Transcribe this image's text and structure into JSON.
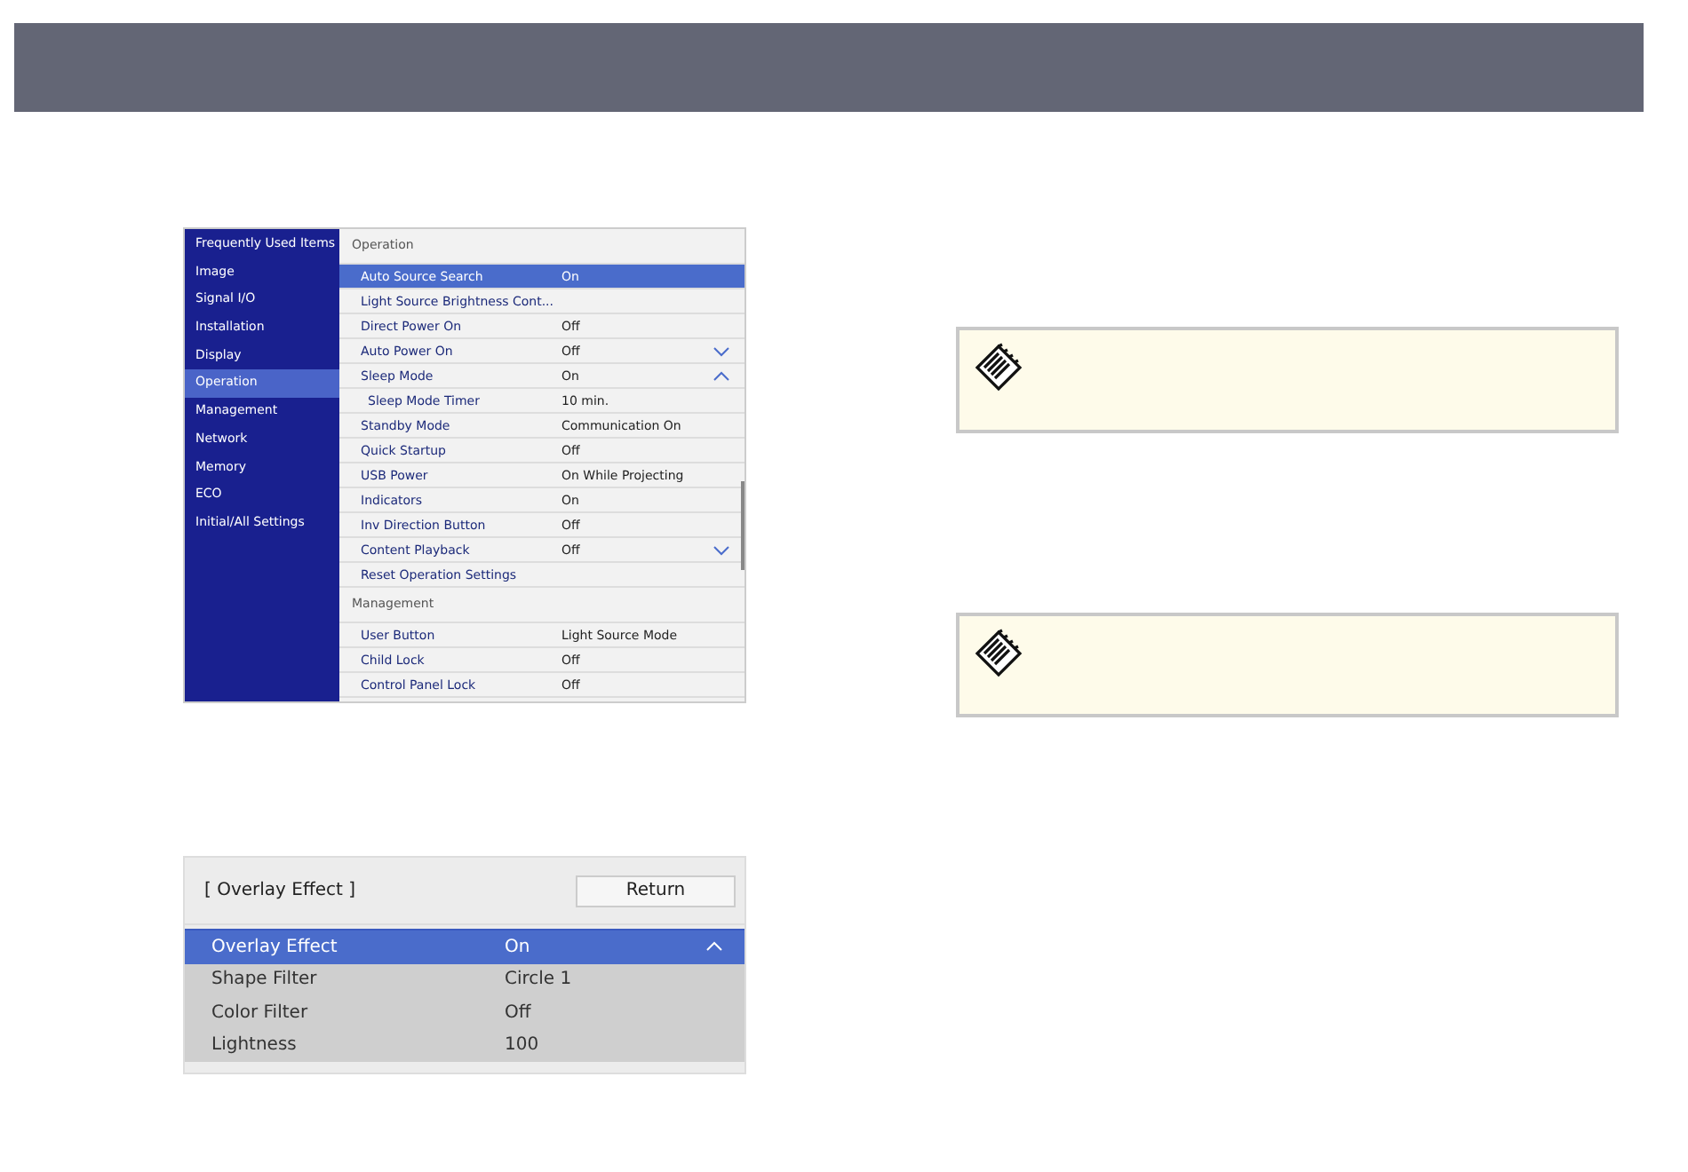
{
  "menu": {
    "sidebar": [
      {
        "label": "Frequently Used Items",
        "selected": false
      },
      {
        "label": "Image",
        "selected": false
      },
      {
        "label": "Signal I/O",
        "selected": false
      },
      {
        "label": "Installation",
        "selected": false
      },
      {
        "label": "Display",
        "selected": false
      },
      {
        "label": "Operation",
        "selected": true
      },
      {
        "label": "Management",
        "selected": false
      },
      {
        "label": "Network",
        "selected": false
      },
      {
        "label": "Memory",
        "selected": false
      },
      {
        "label": "ECO",
        "selected": false
      },
      {
        "label": "Initial/All Settings",
        "selected": false
      }
    ],
    "sections": [
      {
        "title": "Operation",
        "rows": [
          {
            "label": "Auto Source Search",
            "value": "On",
            "selected": true
          },
          {
            "label": "Light Source Brightness Cont...",
            "selected": false
          },
          {
            "label": "Direct Power On",
            "value": "Off",
            "selected": false
          },
          {
            "label": "Auto Power On",
            "value": "Off",
            "selected": false,
            "expanded": false
          },
          {
            "label": "Sleep Mode",
            "value": "On",
            "selected": false,
            "expanded": true,
            "children": [
              {
                "label": "Sleep Mode Timer",
                "value": "10 min.",
                "selected": false
              }
            ]
          },
          {
            "label": "Standby Mode",
            "value": "Communication On",
            "selected": false
          },
          {
            "label": "Quick Startup",
            "value": "Off",
            "selected": false
          },
          {
            "label": "USB Power",
            "value": "On While Projecting",
            "selected": false
          },
          {
            "label": "Indicators",
            "value": "On",
            "selected": false
          },
          {
            "label": "Inv Direction Button",
            "value": "Off",
            "selected": false
          },
          {
            "label": "Content Playback",
            "value": "Off",
            "selected": false,
            "expanded": false
          },
          {
            "label": "Reset Operation Settings",
            "selected": false
          }
        ]
      },
      {
        "title": "Management",
        "rows": [
          {
            "label": "User Button",
            "value": "Light Source Mode",
            "selected": false
          },
          {
            "label": "Child Lock",
            "value": "Off",
            "selected": false
          },
          {
            "label": "Control Panel Lock",
            "value": "Off",
            "selected": false
          }
        ]
      }
    ]
  },
  "overlay": {
    "title": "[ Overlay Effect ]",
    "return_button": "Return",
    "rows": [
      {
        "label": "Overlay Effect",
        "value": "On",
        "selected": true,
        "expanded": true
      },
      {
        "label": "Shape Filter",
        "value": "Circle 1",
        "selected": false
      },
      {
        "label": "Color Filter",
        "value": "Off",
        "selected": false
      },
      {
        "label": "Lightness",
        "value": "100",
        "selected": false
      }
    ]
  },
  "notes": [
    {
      "kind": "note"
    },
    {
      "kind": "note"
    }
  ]
}
